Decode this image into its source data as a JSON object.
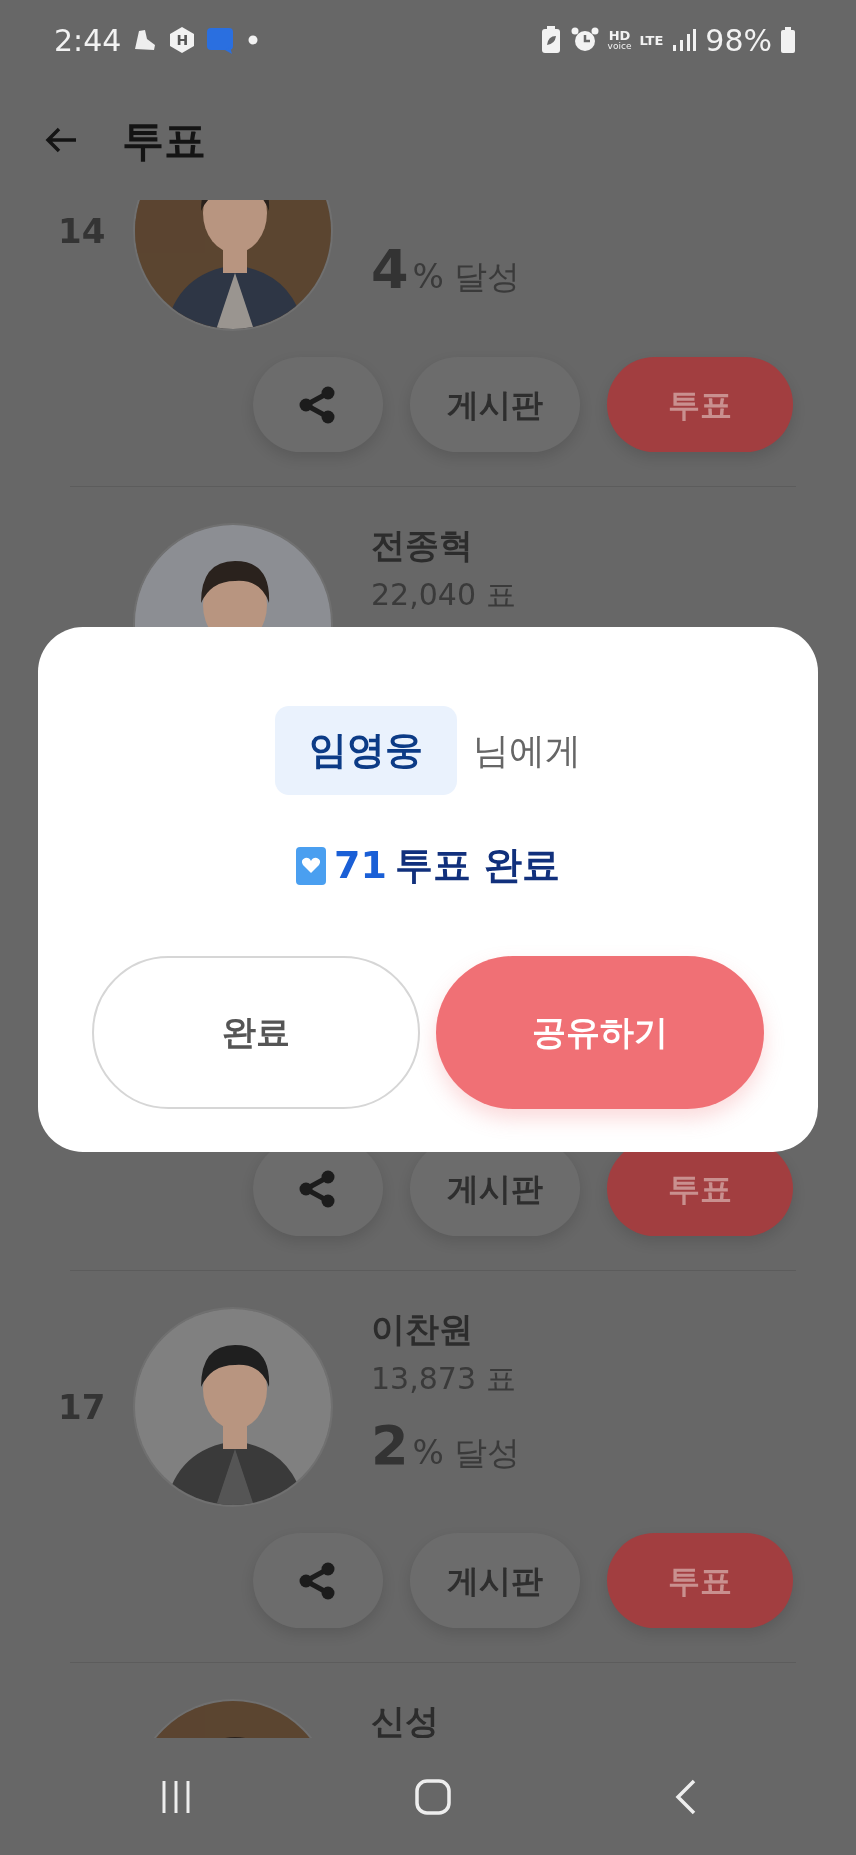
{
  "status_bar": {
    "time": "2:44",
    "app_letter": "H",
    "hd": "HD",
    "voice": "voice",
    "lte": "LTE",
    "battery": "98%"
  },
  "header": {
    "title": "투표"
  },
  "candidates": [
    {
      "rank": "14",
      "percent": "4",
      "percent_suffix": "% 달성",
      "board": "게시판",
      "vote": "투표"
    },
    {
      "name": "전종혁",
      "votes": "22,040 표"
    },
    {
      "board": "게시판",
      "vote": "투표"
    },
    {
      "rank": "17",
      "name": "이찬원",
      "votes": "13,873 표",
      "percent": "2",
      "percent_suffix": "% 달성",
      "board": "게시판",
      "vote": "투표"
    },
    {
      "name": "신성"
    }
  ],
  "dialog": {
    "recipient": "임영웅",
    "recipient_suffix": "님에게",
    "count": "71",
    "result": "투표 완료",
    "buttons": [
      {
        "label": "완료",
        "kind": "secondary"
      },
      {
        "label": "공유하기",
        "kind": "primary"
      }
    ]
  }
}
